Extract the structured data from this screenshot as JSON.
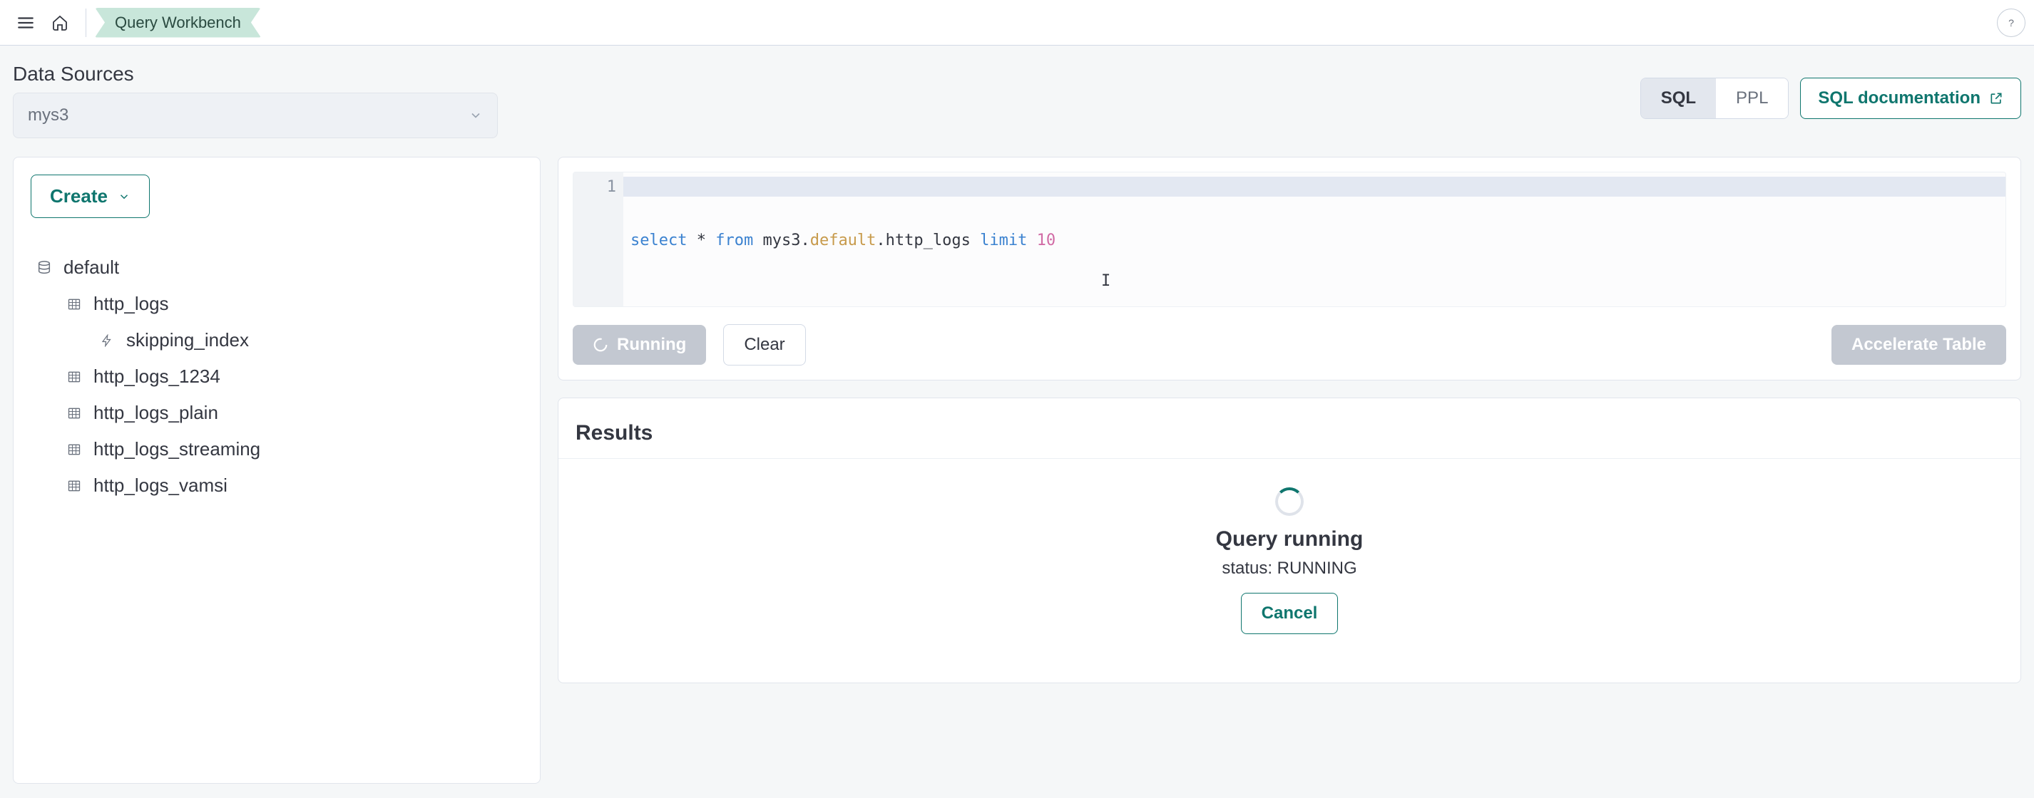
{
  "topbar": {
    "breadcrumb": "Query Workbench"
  },
  "dataSources": {
    "label": "Data Sources",
    "selected": "mys3"
  },
  "langToggle": {
    "sql": "SQL",
    "ppl": "PPL"
  },
  "docLink": "SQL documentation",
  "createButton": "Create",
  "tree": {
    "db": "default",
    "tables": [
      {
        "name": "http_logs",
        "indexes": [
          "skipping_index"
        ]
      },
      {
        "name": "http_logs_1234"
      },
      {
        "name": "http_logs_plain"
      },
      {
        "name": "http_logs_streaming"
      },
      {
        "name": "http_logs_vamsi"
      }
    ]
  },
  "editor": {
    "lineNumber": "1",
    "tokens": {
      "select": "select",
      "star": "*",
      "from": "from",
      "path1": "mys3.",
      "ns": "default",
      "path2": ".http_logs",
      "limit": "limit",
      "num": "10"
    }
  },
  "buttons": {
    "running": "Running",
    "clear": "Clear",
    "accelerate": "Accelerate Table",
    "cancel": "Cancel"
  },
  "results": {
    "heading": "Results",
    "title": "Query running",
    "status": "status: RUNNING"
  }
}
